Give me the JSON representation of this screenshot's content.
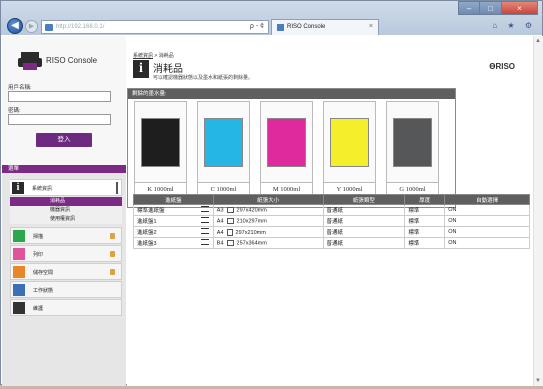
{
  "browser": {
    "address": "http://192.168.0.1/",
    "address_tools": "ρ - ¢",
    "tab_title": "RISO Console",
    "tab_close": "×",
    "toolbar_icons": "⌂ ★ ⚙",
    "back": "◀",
    "forward": "▶",
    "min": "–",
    "max": "□",
    "close": "×"
  },
  "sidebar": {
    "logo_text": "RISO Console",
    "username_label": "用戶名稱:",
    "password_label": "密碼:",
    "login_label": "登入",
    "menu_title": "選單",
    "items": [
      {
        "label": "系統資訊",
        "icon": "info-icon"
      },
      {
        "label": "掃描",
        "icon": "scan-icon"
      },
      {
        "label": "列印",
        "icon": "print-icon"
      },
      {
        "label": "儲存空間",
        "icon": "storage-icon"
      },
      {
        "label": "工作狀態",
        "icon": "job-status-icon"
      },
      {
        "label": "維護",
        "icon": "maintenance-icon"
      }
    ],
    "sub_items": [
      {
        "label": "消耗品"
      },
      {
        "label": "機器資訊"
      },
      {
        "label": "使用權資訊"
      }
    ]
  },
  "content": {
    "breadcrumb_link": "系統資訊",
    "breadcrumb_sep": " > ",
    "breadcrumb_current": "消耗品",
    "title": "消耗品",
    "description": "可以確認機器狀態以及墨水和紙張的剩餘量。",
    "brand": "ƟRISO",
    "ink_heading": "剩餘的墨水量:",
    "inks": [
      {
        "label": "K 1000ml",
        "color": "#1e1e1e"
      },
      {
        "label": "C 1000ml",
        "color": "#25b6e6"
      },
      {
        "label": "M 1000ml",
        "color": "#df2a9e"
      },
      {
        "label": "Y 1000ml",
        "color": "#f4ee2b"
      },
      {
        "label": "G 1000ml",
        "color": "#555759"
      }
    ],
    "table_headers": [
      "進紙盤",
      "紙張大小",
      "紙張類型",
      "厚度",
      "自動選擇"
    ],
    "rows": [
      {
        "tray": "標準進紙盤",
        "size": "A3",
        "dims": "297x420mm",
        "type": "普通紙",
        "thickness": "標準",
        "auto": "ON"
      },
      {
        "tray": "進紙盤1",
        "size": "A4",
        "dims": "210x297mm",
        "type": "普通紙",
        "thickness": "標準",
        "auto": "ON"
      },
      {
        "tray": "進紙盤2",
        "size": "A4",
        "dims": "297x210mm",
        "type": "普通紙",
        "thickness": "標準",
        "auto": "ON"
      },
      {
        "tray": "進紙盤3",
        "size": "B4",
        "dims": "257x364mm",
        "type": "普通紙",
        "thickness": "標準",
        "auto": "ON"
      }
    ]
  }
}
